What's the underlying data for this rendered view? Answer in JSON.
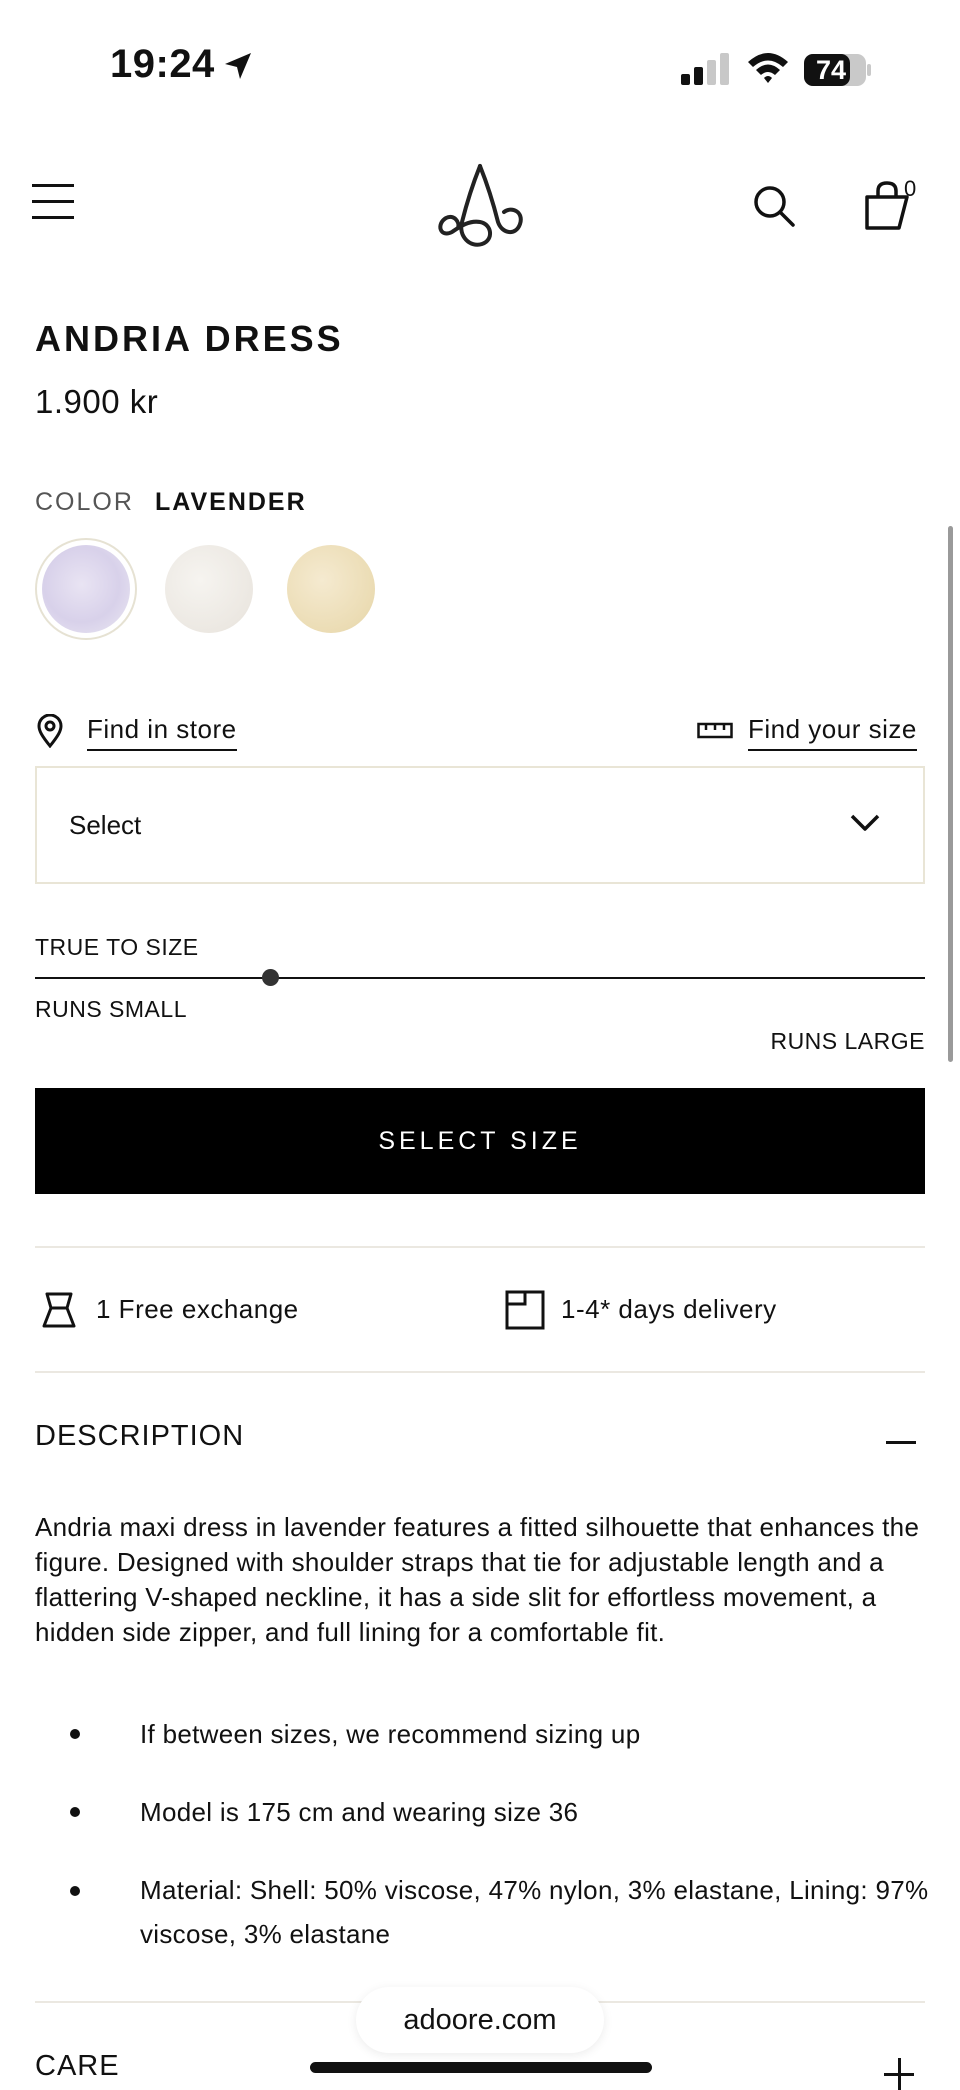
{
  "status_bar": {
    "time": "19:24",
    "battery": "74"
  },
  "header": {
    "bag_count": "0",
    "icons": [
      "menu-icon",
      "brand-logo",
      "search-icon",
      "shopping-bag-icon"
    ]
  },
  "product": {
    "title": "ANDRIA DRESS",
    "price": "1.900 kr"
  },
  "color": {
    "label": "COLOR",
    "selected": "LAVENDER",
    "swatches": [
      "#ddd6ec",
      "#eeebe5",
      "#ecdcb6"
    ]
  },
  "links": {
    "find_in_store": "Find in store",
    "find_your_size": "Find your size"
  },
  "size_select": {
    "value": "Select"
  },
  "fit": {
    "label": "TRUE TO SIZE",
    "min_label": "RUNS SMALL",
    "max_label": "RUNS LARGE",
    "position_fraction": 0.265
  },
  "cta": {
    "label": "SELECT SIZE"
  },
  "perks": {
    "exchange": "1 Free exchange",
    "delivery": "1-4* days delivery"
  },
  "description": {
    "heading": "DESCRIPTION",
    "body": "Andria maxi dress in lavender features a fitted silhouette that enhances the figure. Designed with shoulder straps that tie for adjustable length and a flattering V-shaped neckline, it has a side slit for effortless movement, a hidden side zipper, and full lining for a comfortable fit.",
    "bullets": [
      "If between sizes, we recommend sizing up",
      "Model is 175 cm and wearing size 36",
      "Material: Shell: 50% viscose, 47% nylon, 3% elastane, Lining: 97% viscose, 3% elastane"
    ]
  },
  "care": {
    "heading": "CARE"
  },
  "browser": {
    "url": "adoore.com"
  }
}
